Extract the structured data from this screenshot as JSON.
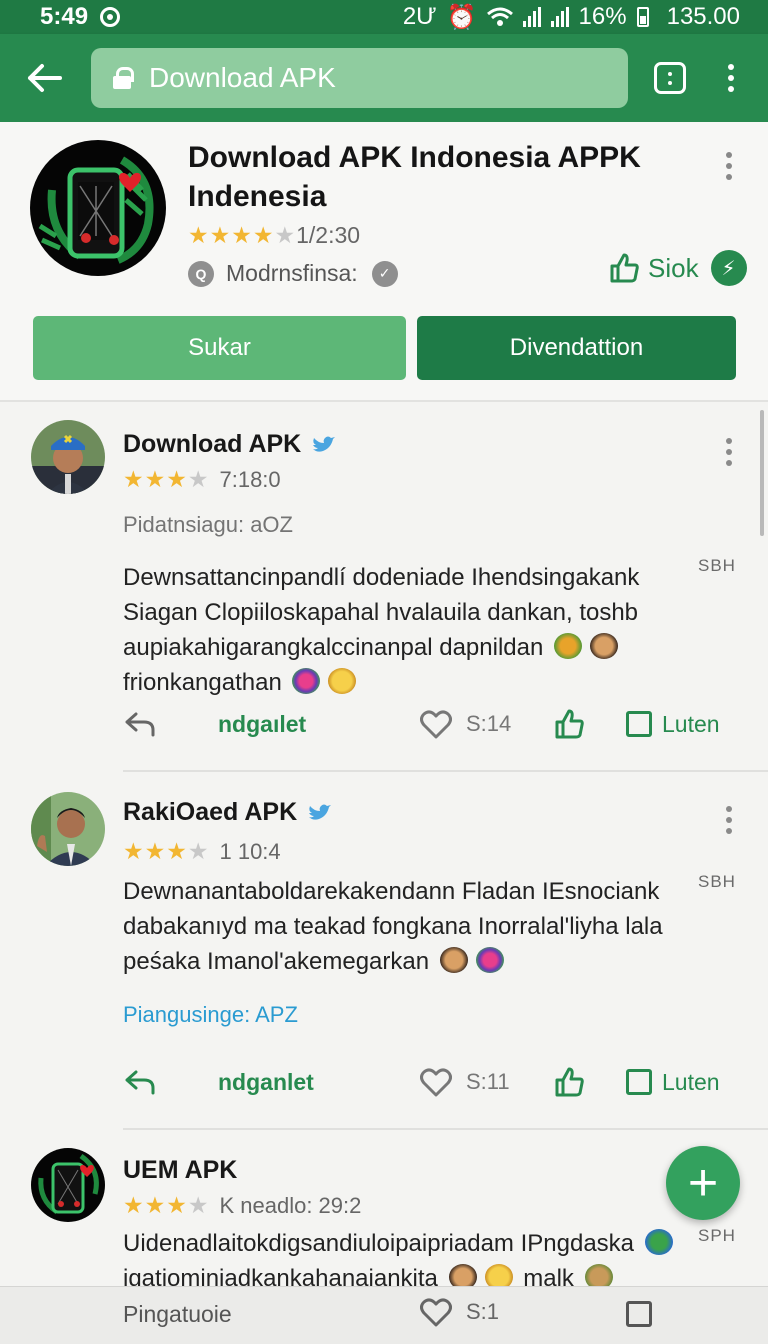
{
  "status_bar": {
    "time": "5:49",
    "indicators": "2Ư",
    "battery": "16%",
    "extra": "135.00"
  },
  "toolbar": {
    "url": "Download APK"
  },
  "app": {
    "title": "Download APK Indonesia APPK Indenesia",
    "rating_meta": "1/2:30",
    "developer": "Modrnsfinsa:",
    "like_label": "Siok",
    "button_primary": "Sukar",
    "button_secondary": "Divendattion",
    "stars_filled": 4,
    "stars_total": 5
  },
  "posts": [
    {
      "name": "Download APK",
      "verified": true,
      "rating_meta": "7:18:0",
      "subline": "Pidatnsiagu: aOZ",
      "tag": "SBH",
      "body": "Dewnsattancinpandlí dodeniade Ihendsingakank Siagan Clopiiloskapahal hvalauila dankan, toshb aupiakahigarangkalccinanpal dapnildan",
      "body_tail": "frionkangathan",
      "action_label": "ndgaılet",
      "likes": "S:14",
      "save_label": "Luten",
      "stars_filled": 3,
      "stars_total": 5
    },
    {
      "name": "RakiOaed APK",
      "verified": true,
      "rating_meta": "1 10:4",
      "tag": "SBH",
      "body": "Dewnanantaboldarekakendann Fladan IEsnociank dabakanıyd ma teakad fongkana Inorralal'liyha lala peśaka Imanol'akemegarkan",
      "subline": "Piangusinge: APZ",
      "action_label": "ndganlet",
      "likes": "S:11",
      "save_label": "Luten",
      "stars_filled": 3,
      "stars_total": 5
    },
    {
      "name": "UEM APK",
      "verified": false,
      "rating_meta": "K neadlo: 29:2",
      "tag": "SPH",
      "body": "Uidenadlaitokdigsandiuloipaipriadam IPngdaska",
      "body_tail": "igatiominiadkankahanajankita",
      "body_tail2": "malk",
      "stars_filled": 3,
      "stars_total": 5
    }
  ],
  "fab": {
    "label": "+"
  },
  "bottom_bar": {
    "label": "Pingatuoie",
    "likes": "S:1"
  },
  "colors": {
    "brand": "#278a4f",
    "brand_dark": "#1e7b47",
    "brand_light": "#5db777",
    "star": "#f2b632",
    "link": "#2a9bd1"
  }
}
